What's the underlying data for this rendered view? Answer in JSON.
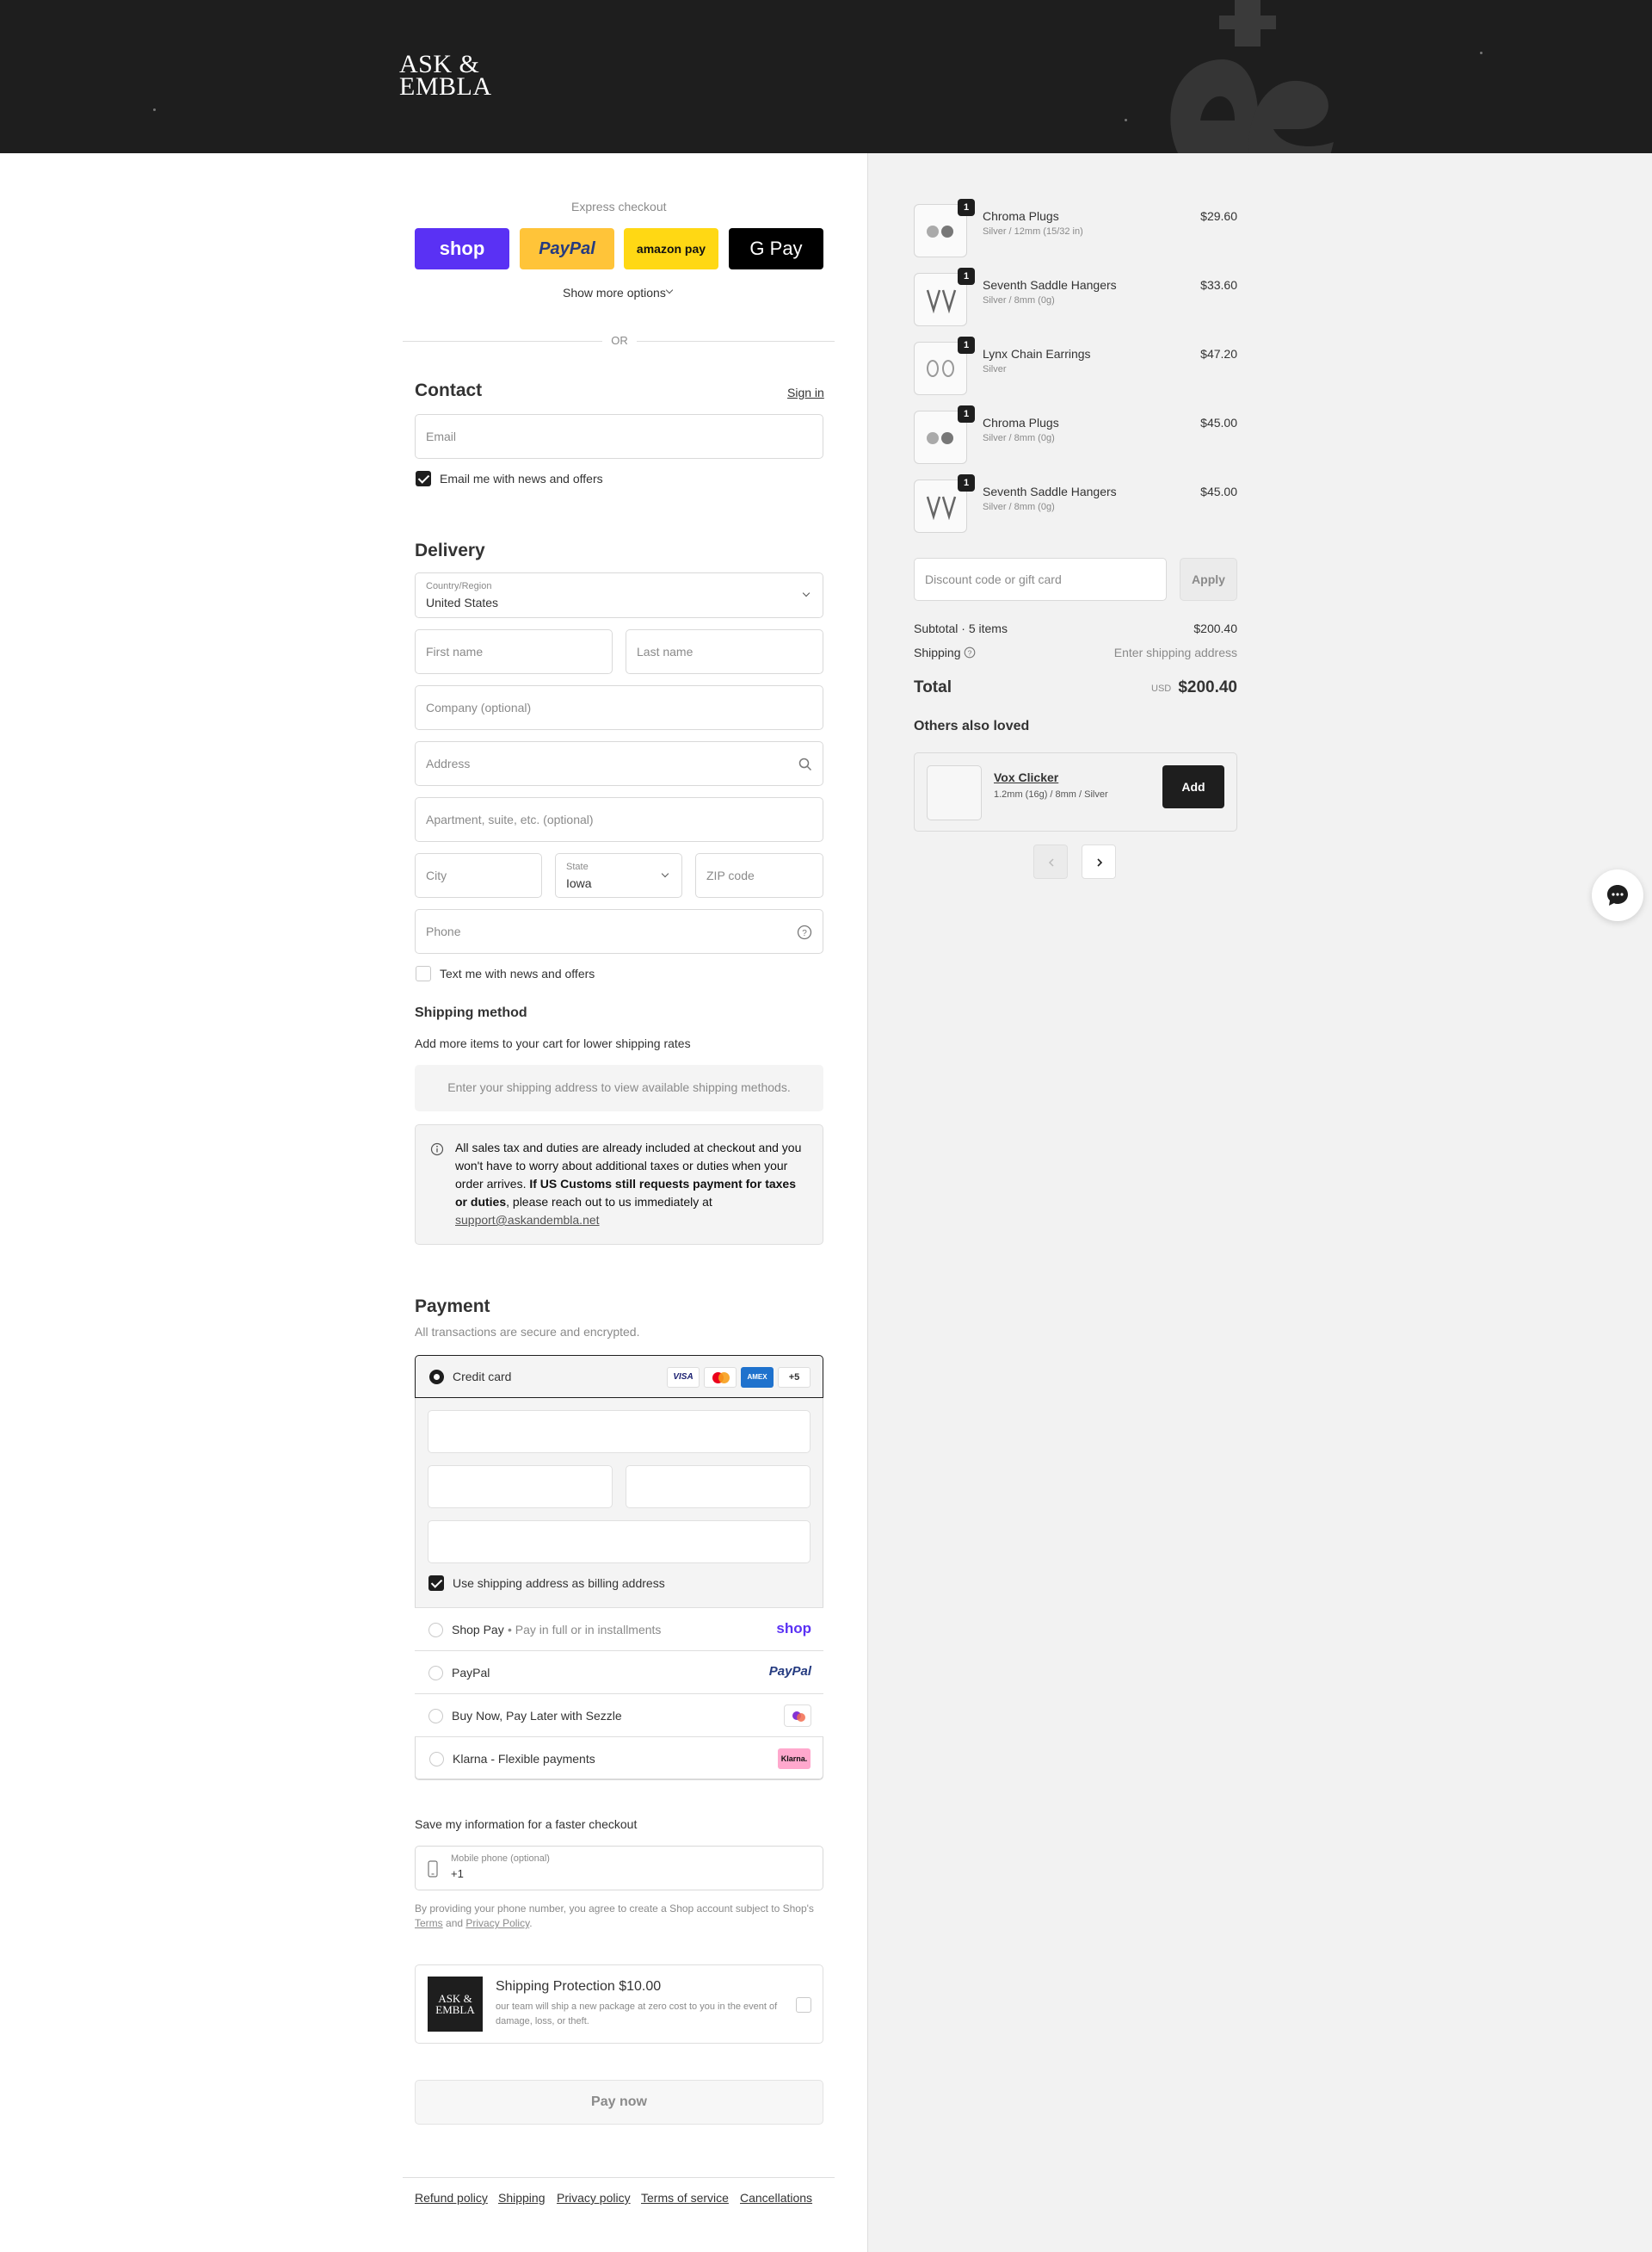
{
  "brand": {
    "logo_line1": "ASK &",
    "logo_line2": "EMBLA"
  },
  "express": {
    "title": "Express checkout",
    "buttons": [
      {
        "label": "shop",
        "color": "#5a31f4"
      },
      {
        "label": "PayPal",
        "color": "#ffc439"
      },
      {
        "label": "amazon pay",
        "color": "#ffd814"
      },
      {
        "label": "G Pay",
        "color": "#000000"
      }
    ],
    "more": "Show more options",
    "or": "OR"
  },
  "contact": {
    "heading": "Contact",
    "sign_in": "Sign in",
    "email_placeholder": "Email",
    "news_label": "Email me with news and offers"
  },
  "delivery": {
    "heading": "Delivery",
    "country_label": "Country/Region",
    "country_value": "United States",
    "first_name": "First name",
    "last_name": "Last name",
    "company": "Company (optional)",
    "address": "Address",
    "apartment": "Apartment, suite, etc. (optional)",
    "city": "City",
    "state_label": "State",
    "state_value": "Iowa",
    "zip": "ZIP code",
    "phone": "Phone",
    "text_label": "Text me with news and offers"
  },
  "shipping_method": {
    "heading": "Shipping method",
    "note": "Add more items to your cart for lower shipping rates",
    "box": "Enter your shipping address to view available shipping methods."
  },
  "notice": {
    "text1": "All sales tax and duties are already included at checkout and you won't have to worry about additional taxes or duties when your order arrives.",
    "bold": "If US Customs still requests payment for taxes or duties",
    "text2": ", please reach out to us immediately at",
    "email": "support@askandembla.net"
  },
  "payment": {
    "heading": "Payment",
    "subtitle": "All transactions are secure and encrypted.",
    "credit_card": "Credit card",
    "card_badges": [
      "VISA",
      "MC",
      "AMEX",
      "+5"
    ],
    "billing_label": "Use shipping address as billing address",
    "shop_pay": "Shop Pay",
    "shop_pay_sub": "Pay in full or in installments",
    "shop_logo": "shop",
    "paypal": "PayPal",
    "paypal_logo": "PayPal",
    "sezzle": "Buy Now, Pay Later with Sezzle",
    "klarna": "Klarna - Flexible payments",
    "klarna_logo": "Klarna."
  },
  "save_info": {
    "heading": "Save my information for a faster checkout",
    "phone_label": "Mobile phone (optional)",
    "phone_value": "+1",
    "legal1": "By providing your phone number, you agree to create a Shop account subject to Shop's",
    "terms": "Terms",
    "and": "and",
    "privacy": "Privacy Policy",
    "dot": "."
  },
  "protection": {
    "title": "Shipping Protection $10.00",
    "desc": "our team will ship a new package at zero cost to you in the event of damage, loss, or theft.",
    "logo1": "ASK &",
    "logo2": "EMBLA"
  },
  "pay_now": "Pay now",
  "footer": [
    "Refund policy",
    "Shipping",
    "Privacy policy",
    "Terms of service",
    "Cancellations"
  ],
  "cart": {
    "items": [
      {
        "qty": "1",
        "name": "Chroma Plugs",
        "variant": "Silver / 12mm (15/32 in)",
        "price": "$29.60"
      },
      {
        "qty": "1",
        "name": "Seventh Saddle Hangers",
        "variant": "Silver / 8mm (0g)",
        "price": "$33.60"
      },
      {
        "qty": "1",
        "name": "Lynx Chain Earrings",
        "variant": "Silver",
        "price": "$47.20"
      },
      {
        "qty": "1",
        "name": "Chroma Plugs",
        "variant": "Silver / 8mm (0g)",
        "price": "$45.00"
      },
      {
        "qty": "1",
        "name": "Seventh Saddle Hangers",
        "variant": "Silver / 8mm (0g)",
        "price": "$45.00"
      }
    ],
    "discount_placeholder": "Discount code or gift card",
    "apply": "Apply",
    "subtotal_label": "Subtotal · 5 items",
    "subtotal_value": "$200.40",
    "shipping_label": "Shipping",
    "shipping_value": "Enter shipping address",
    "total_label": "Total",
    "currency": "USD",
    "total_value": "$200.40",
    "others_heading": "Others also loved",
    "rec_name": "Vox Clicker",
    "rec_variant": "1.2mm (16g) / 8mm / Silver",
    "rec_add": "Add"
  }
}
